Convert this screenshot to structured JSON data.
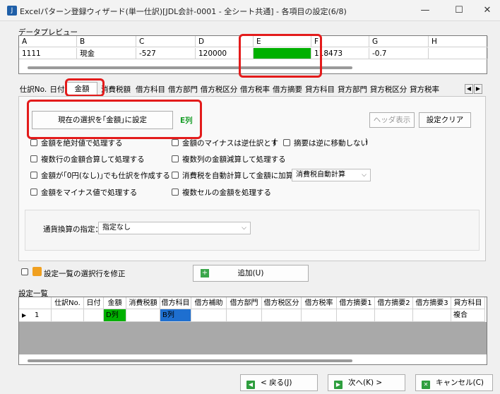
{
  "window": {
    "title": "Excelパターン登録ウィザード(単一仕訳)[JDL会計-0001 - 全シート共通] - 各項目の設定(6/8)",
    "minimize": "—",
    "maximize": "☐",
    "close": "✕"
  },
  "preview": {
    "label": "データプレビュー",
    "columns": [
      "A",
      "B",
      "C",
      "D",
      "E",
      "F",
      "G",
      "H"
    ],
    "row": [
      "1111",
      "現金",
      "-527",
      "120000",
      "",
      "118473",
      "-0.7",
      ""
    ],
    "highlight_color": "#00b000"
  },
  "tabs": [
    "仕訳No.",
    "日付",
    "金額",
    "消費税額",
    "借方科目",
    "借方部門",
    "借方税区分",
    "借方税率",
    "借方摘要",
    "貸方科目",
    "貸方部門",
    "貸方税区分",
    "貸方税率"
  ],
  "active_tab": "金額",
  "panel": {
    "set_current_label": "現在の選択を｢金額｣に設定",
    "column_indicator": "E列",
    "header_display_label": "ヘッダ表示",
    "clear_label": "設定クリア",
    "checks_left": [
      "金額を絶対値で処理する",
      "複数行の金額合算して処理する",
      "金額が｢0円(なし)｣でも仕訳を作成する",
      "金額をマイナス値で処理する"
    ],
    "checks_right": [
      "金額のマイナスは逆仕訳とす",
      "複数列の金額減算して処理する",
      "消費税を自動計算して金額に加算",
      "複数セルの金額を処理する"
    ],
    "paren_open": "(",
    "paren_close": ")",
    "reverse_no_move": "摘要は逆に移動しない",
    "tax_auto_calc": "消費税自動計算",
    "currency_label": "通貨換算の指定：",
    "currency_value": "指定なし"
  },
  "modify_selected_label": "設定一覧の選択行を修正",
  "add_label": "追加(U)",
  "list": {
    "label": "設定一覧",
    "headers": [
      "",
      "仕訳No.",
      "日付",
      "金額",
      "消費税額",
      "借方科目",
      "借方補助",
      "借方部門",
      "借方税区分",
      "借方税率",
      "借方摘要1",
      "借方摘要2",
      "借方摘要3",
      "貸方科目"
    ],
    "row": [
      "1",
      "",
      "",
      "D列",
      "",
      "B列",
      "",
      "",
      "",
      "",
      "",
      "",
      "",
      "複合"
    ],
    "amount_color": "#00b000",
    "account_color": "#1e6fd0"
  },
  "nav": {
    "back": "< 戻る(J)",
    "next": "次へ(K) >",
    "cancel": "キャンセル(C)"
  }
}
